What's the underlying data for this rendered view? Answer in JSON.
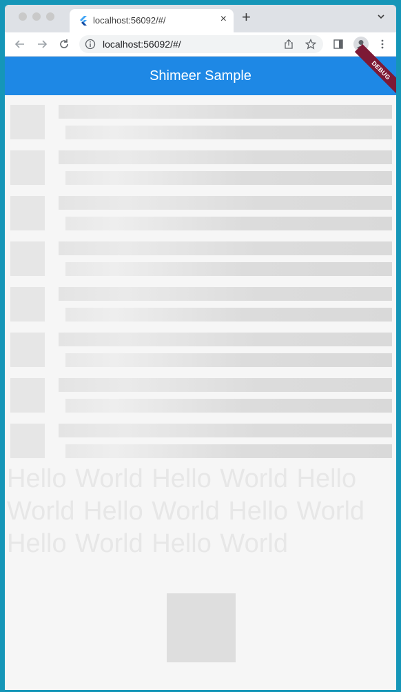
{
  "browser": {
    "tab_title": "localhost:56092/#/",
    "tab_close_label": "×",
    "new_tab_label": "+",
    "url": "localhost:56092/#/"
  },
  "app": {
    "title": "Shimeer Sample",
    "debug_banner": "DEBUG",
    "accent_color": "#1e88e5",
    "shimmer_rows": 8,
    "shimmer_text": "Hello World Hello World Hello World Hello World Hello World Hello World Hello World"
  },
  "icons": {
    "back": "back-arrow-icon",
    "forward": "forward-arrow-icon",
    "reload": "reload-icon",
    "info": "info-icon",
    "share": "share-icon",
    "bookmark": "star-icon",
    "sidepanel": "side-panel-icon",
    "profile": "profile-icon",
    "menu": "kebab-menu-icon"
  }
}
